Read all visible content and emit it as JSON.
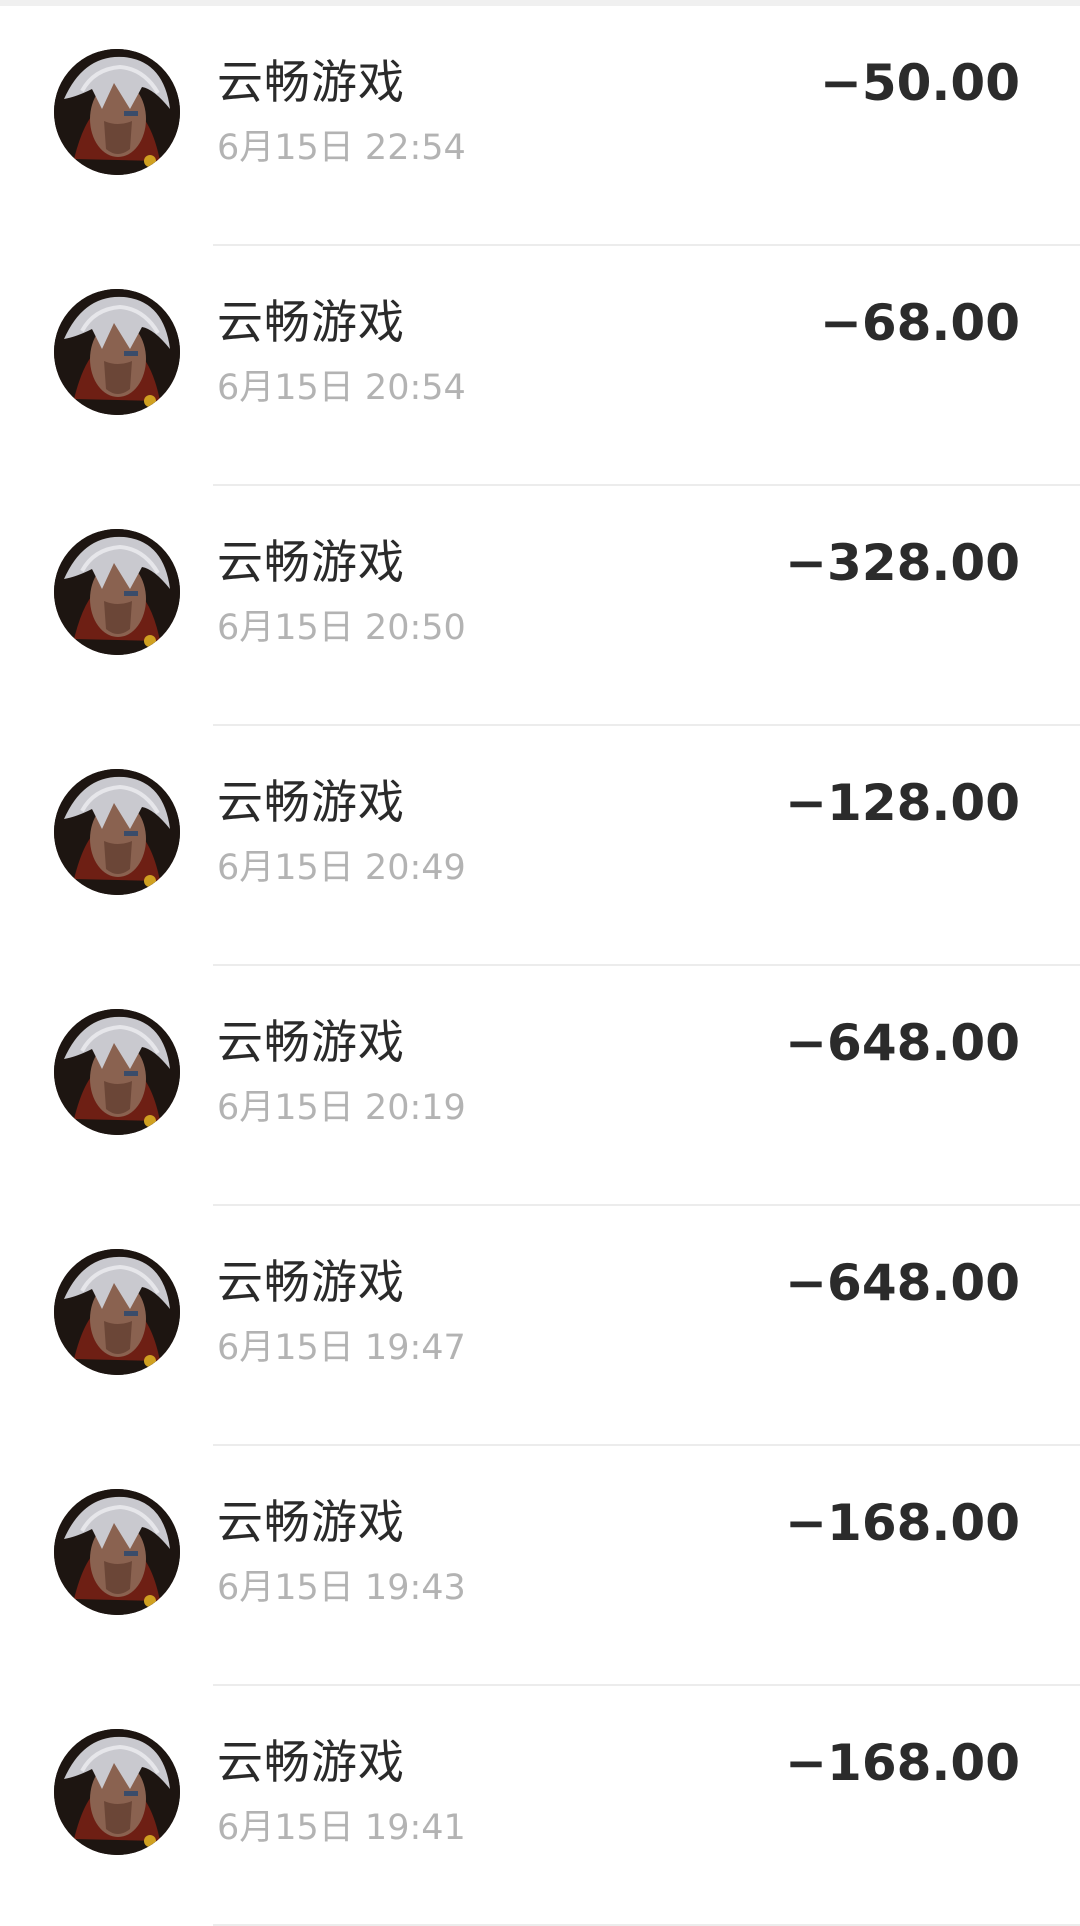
{
  "transactions": [
    {
      "merchant": "云畅游戏",
      "time": "6月15日 22:54",
      "amount": "−50.00",
      "icon": "game-character-avatar"
    },
    {
      "merchant": "云畅游戏",
      "time": "6月15日 20:54",
      "amount": "−68.00",
      "icon": "game-character-avatar"
    },
    {
      "merchant": "云畅游戏",
      "time": "6月15日 20:50",
      "amount": "−328.00",
      "icon": "game-character-avatar"
    },
    {
      "merchant": "云畅游戏",
      "time": "6月15日 20:49",
      "amount": "−128.00",
      "icon": "game-character-avatar"
    },
    {
      "merchant": "云畅游戏",
      "time": "6月15日 20:19",
      "amount": "−648.00",
      "icon": "game-character-avatar"
    },
    {
      "merchant": "云畅游戏",
      "time": "6月15日 19:47",
      "amount": "−648.00",
      "icon": "game-character-avatar"
    },
    {
      "merchant": "云畅游戏",
      "time": "6月15日 19:43",
      "amount": "−168.00",
      "icon": "game-character-avatar"
    },
    {
      "merchant": "云畅游戏",
      "time": "6月15日 19:41",
      "amount": "−168.00",
      "icon": "game-character-avatar"
    }
  ],
  "colors": {
    "text_primary": "#2a2a2a",
    "text_secondary": "#b3b3b3",
    "divider": "#ececec",
    "background": "#ffffff"
  }
}
